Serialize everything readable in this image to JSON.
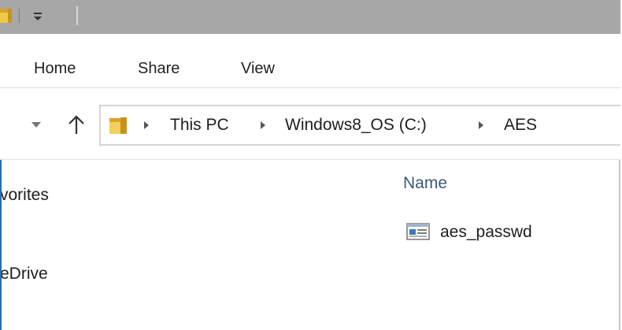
{
  "window": {
    "quick_access_dropdown_icon": "dropdown-arrow-with-line",
    "folder_icon": "folder-icon"
  },
  "ribbon": {
    "tabs": [
      {
        "label": "Home"
      },
      {
        "label": "Share"
      },
      {
        "label": "View"
      }
    ]
  },
  "nav": {
    "recent_icon": "chevron-down-icon",
    "up_icon": "up-arrow-icon"
  },
  "address": {
    "crumbs": [
      "This PC",
      "Windows8_OS (C:)",
      "AES"
    ]
  },
  "navpane": {
    "items": [
      {
        "label": "vorites"
      },
      {
        "label": "eDrive"
      }
    ]
  },
  "filelist": {
    "column_header": "Name",
    "files": [
      {
        "name": "aes_passwd",
        "icon": "document-icon"
      }
    ]
  },
  "colors": {
    "titlebar": "#a7a7a7",
    "folder": "#e8b830",
    "header_text": "#3b5a7a",
    "accent": "#2b6cb0"
  }
}
